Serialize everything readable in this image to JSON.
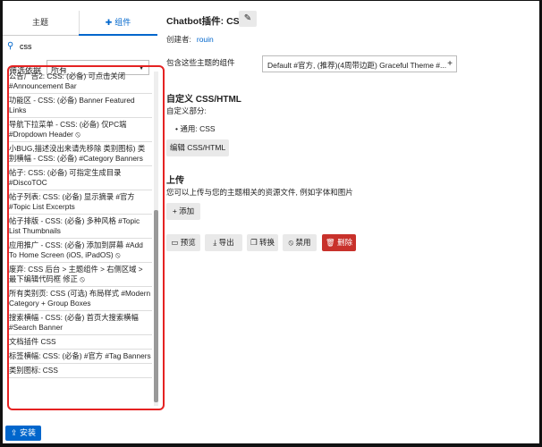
{
  "tabs": {
    "topics": "主题",
    "components": "组件"
  },
  "search": {
    "query": "css"
  },
  "filter": {
    "label": "筛选依据",
    "value": "所有"
  },
  "list": {
    "items": [
      "公告广告2: CSS: (必备) 可点击关闭 #Announcement Bar",
      "功能区 - CSS: (必备) Banner Featured Links",
      "导航下拉菜单 - CSS: (必备) 仅PC端 #Dropdown Header ⦸",
      "小BUG,描述没出来请先移除 类别图标) 类别横幅 - CSS: (必备) #Category Banners",
      "帖子: CSS: (必备) 可指定生成目录 #DiscoTOC",
      "帖子列表: CSS: (必备) 显示摘录 #官方 #Topic List Excerpts",
      "帖子排版 - CSS: (必备) 多种风格 #Topic List Thumbnails",
      "应用推广 - CSS: (必备) 添加到屏幕 #Add To Home Screen (iOS, iPadOS) ⦸",
      "废弃: CSS 后台 > 主题组件 > 右侧区域 > 最下编辑代码框 修正 ⦸",
      "所有类别页: CSS (可选) 布局样式 #Modern Category + Group Boxes",
      "搜索横幅 - CSS: (必备) 首页大搜索横幅 #Search Banner",
      "文档插件 CSS",
      "标签横幅: CSS: (必备) #官方 #Tag Banners",
      "类别图标: CSS"
    ]
  },
  "install_label": "安装",
  "detail": {
    "title": "Chatbot插件: CSS",
    "creator_label": "创建者:",
    "creator_name": "rouin",
    "includes_label": "包含这些主题的组件",
    "includes_value": "Default #官方, (推荐)(4周带边距) Graceful Theme #...",
    "css_heading": "自定义 CSS/HTML",
    "css_part_label": "自定义部分:",
    "css_common": "通用: CSS",
    "edit_css_label": "编辑 CSS/HTML",
    "upload_heading": "上传",
    "upload_desc": "您可以上传与您的主题相关的资源文件, 例如字体和图片",
    "add_label": "添加",
    "actions": {
      "preview": "预览",
      "export": "导出",
      "convert": "转换",
      "disable": "禁用",
      "delete": "删除"
    }
  },
  "colors": {
    "accent": "#0066cc",
    "danger": "#c8312b",
    "highlight": "#e52222"
  }
}
